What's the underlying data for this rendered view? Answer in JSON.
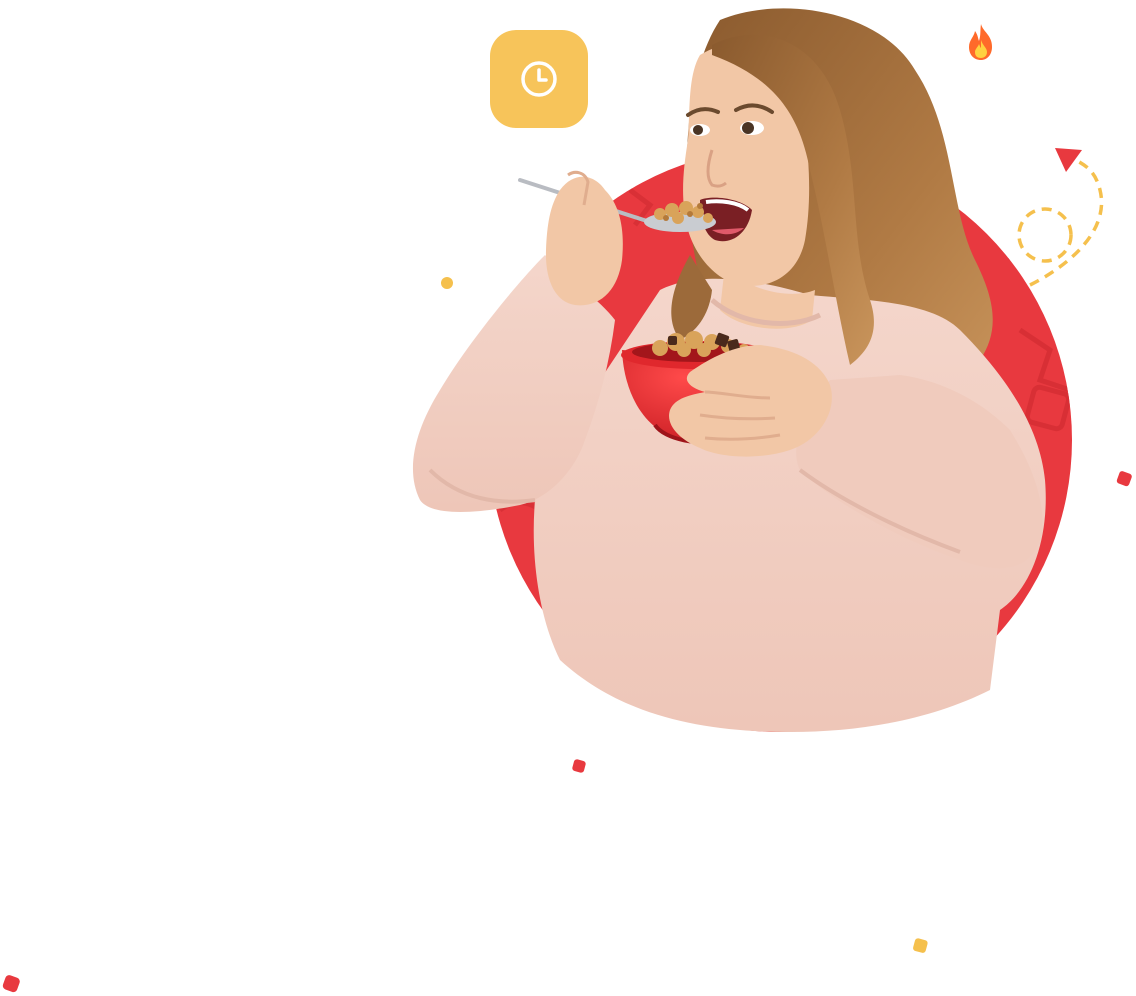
{
  "colors": {
    "circle": "#e8393f",
    "circle_pattern": "#d92f35",
    "sweater": "#f1cfc2",
    "sweater_shadow": "#e2b8a9",
    "skin": "#f2c7a6",
    "hair": "#9c6a3a",
    "bowl": "#e0282d",
    "cereal": "#d9a35a",
    "clock_badge": "#f7c45a",
    "dashes": "#f5c04d",
    "arrow": "#e8393f",
    "dot_red": "#e8393f",
    "dot_yellow": "#f5c04d"
  },
  "icons": {
    "clock": "clock-icon",
    "fire": "fire-icon",
    "arrow": "dashed-arrow-icon"
  }
}
